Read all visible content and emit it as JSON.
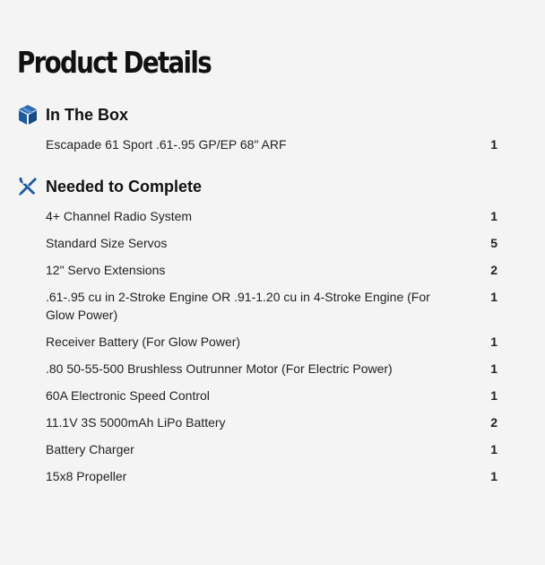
{
  "page": {
    "title": "Product Details"
  },
  "sections": {
    "in_the_box": {
      "title": "In The Box",
      "icon": "box-icon",
      "items": [
        {
          "name": "Escapade 61 Sport .61-.95 GP/EP 68\" ARF",
          "qty": "1"
        }
      ]
    },
    "needed_to_complete": {
      "title": "Needed to Complete",
      "icon": "tools-icon",
      "items": [
        {
          "name": "4+ Channel Radio System",
          "qty": "1"
        },
        {
          "name": "Standard Size Servos",
          "qty": "5"
        },
        {
          "name": "12\" Servo Extensions",
          "qty": "2"
        },
        {
          "name": ".61-.95 cu in 2-Stroke Engine OR .91-1.20 cu in 4-Stroke Engine (For Glow Power)",
          "qty": "1"
        },
        {
          "name": "Receiver Battery (For Glow Power)",
          "qty": "1"
        },
        {
          "name": ".80 50-55-500 Brushless Outrunner Motor (For Electric Power)",
          "qty": "1"
        },
        {
          "name": "60A Electronic Speed Control",
          "qty": "1"
        },
        {
          "name": "11.1V 3S 5000mAh LiPo Battery",
          "qty": "2"
        },
        {
          "name": "Battery Charger",
          "qty": "1"
        },
        {
          "name": "15x8 Propeller",
          "qty": "1"
        }
      ]
    }
  },
  "colors": {
    "icon_blue": "#1f5a9c",
    "background": "#f4f4f4",
    "text": "#222222"
  }
}
